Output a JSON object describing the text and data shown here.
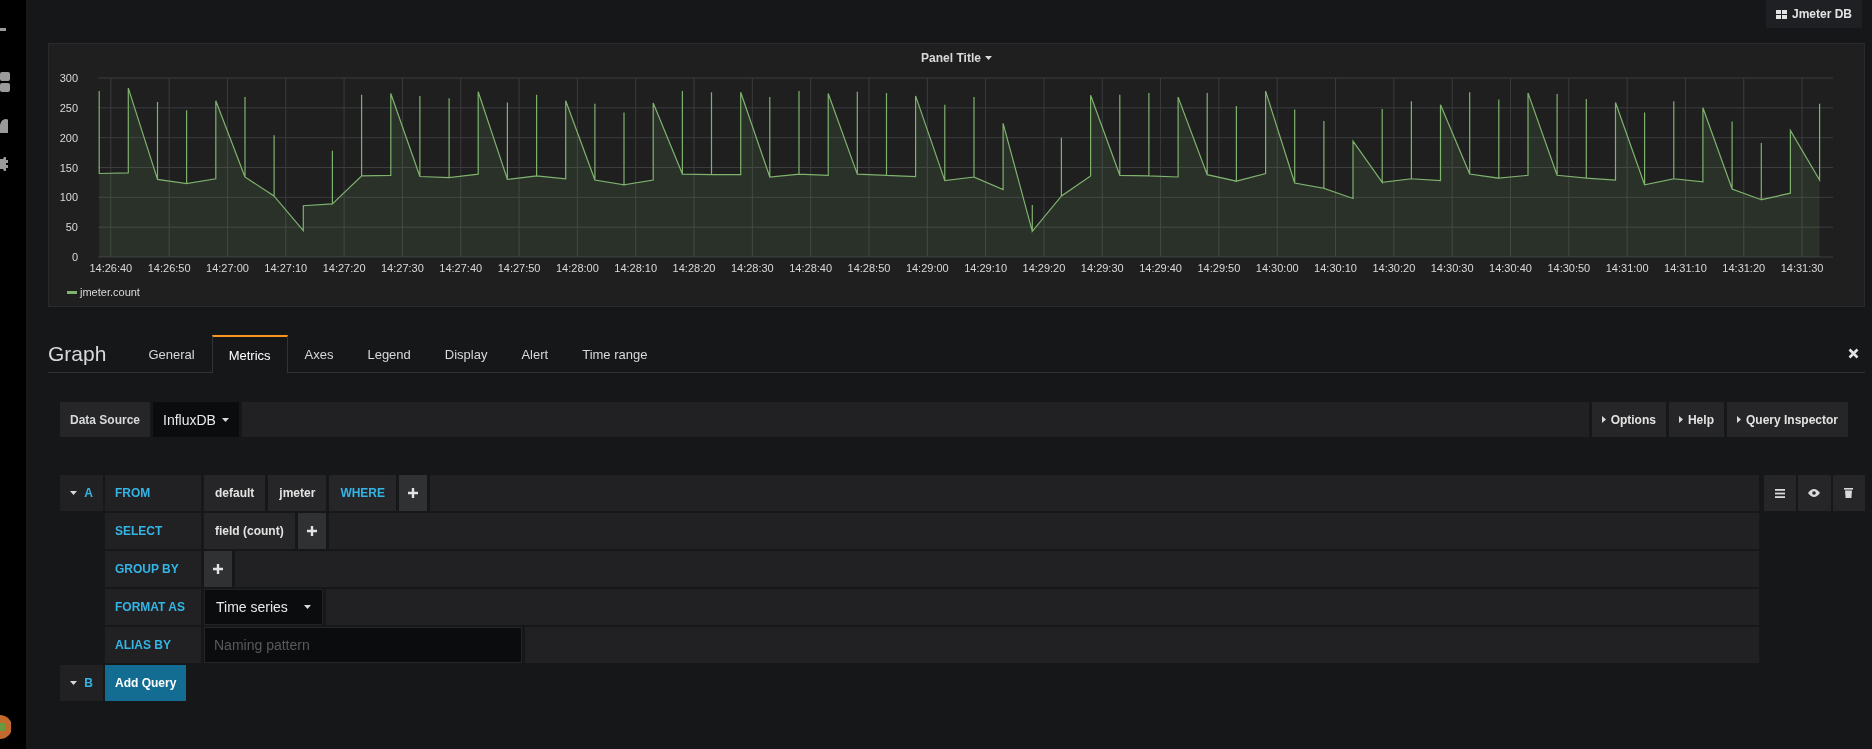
{
  "dashboard_button": {
    "label": "Jmeter DB"
  },
  "panel": {
    "chart_data": {
      "type": "area",
      "title": "Panel Title",
      "x": [
        51998,
        51998,
        52003,
        52003,
        52008,
        52008,
        52008,
        52013,
        52013,
        52013,
        52018,
        52018,
        52023,
        52023,
        52023,
        52028,
        52028,
        52028,
        52033,
        52033,
        52038,
        52038,
        52038,
        52043,
        52043,
        52043,
        52048,
        52048,
        52053,
        52053,
        52053,
        52058,
        52058,
        52058,
        52063,
        52063,
        52068,
        52068,
        52068,
        52073,
        52073,
        52073,
        52078,
        52078,
        52083,
        52083,
        52083,
        52088,
        52088,
        52088,
        52093,
        52093,
        52098,
        52098,
        52098,
        52103,
        52103,
        52103,
        52108,
        52108,
        52113,
        52113,
        52113,
        52118,
        52118,
        52118,
        52123,
        52123,
        52128,
        52128,
        52128,
        52133,
        52133,
        52133,
        52138,
        52138,
        52143,
        52143,
        52143,
        52148,
        52148,
        52148,
        52153,
        52153,
        52158,
        52158,
        52158,
        52163,
        52163,
        52163,
        52168,
        52168,
        52173,
        52173,
        52173,
        52178,
        52178,
        52178,
        52183,
        52183,
        52188,
        52188,
        52188,
        52193,
        52193,
        52193,
        52198,
        52198,
        52203,
        52203,
        52203,
        52208,
        52208,
        52208,
        52213,
        52213,
        52218,
        52218,
        52218,
        52223,
        52223,
        52223,
        52228,
        52228,
        52233,
        52233,
        52233,
        52238,
        52238,
        52238,
        52243,
        52243,
        52248,
        52248,
        52248,
        52253,
        52253,
        52253,
        52258,
        52258,
        52263,
        52263,
        52263,
        52268,
        52268,
        52268,
        52273,
        52273,
        52278,
        52278,
        52278,
        52283,
        52283,
        52283,
        52288,
        52288,
        52293,
        52293
      ],
      "series": [
        {
          "name": "jmeter.count",
          "color": "#7eb26d",
          "values": [
            278,
            140,
            141,
            283,
            130,
            260,
            130,
            123,
            246,
            123,
            131,
            262,
            134,
            268,
            134,
            102,
            204,
            102,
            44,
            86,
            89,
            178,
            89,
            136,
            272,
            136,
            137,
            274,
            135,
            270,
            135,
            133,
            266,
            133,
            139,
            277,
            130,
            259,
            130,
            136,
            272,
            136,
            131,
            262,
            129,
            257,
            129,
            121,
            242,
            121,
            129,
            258,
            139,
            278,
            139,
            138,
            276,
            138,
            138,
            276,
            134,
            268,
            134,
            139,
            278,
            139,
            137,
            274,
            139,
            277,
            139,
            137,
            275,
            137,
            135,
            270,
            128,
            255,
            128,
            134,
            268,
            134,
            113,
            224,
            43,
            87,
            43,
            102,
            200,
            102,
            136,
            271,
            137,
            272,
            137,
            136,
            275,
            136,
            134,
            268,
            138,
            275,
            138,
            127,
            253,
            127,
            140,
            278,
            124,
            247,
            124,
            115,
            228,
            115,
            98,
            194,
            125,
            248,
            125,
            131,
            261,
            131,
            128,
            255,
            139,
            276,
            139,
            132,
            264,
            132,
            137,
            275,
            137,
            273,
            137,
            132,
            265,
            132,
            129,
            259,
            121,
            242,
            121,
            131,
            261,
            131,
            126,
            250,
            114,
            227,
            114,
            96,
            191,
            96,
            107,
            212,
            129,
            257
          ]
        }
      ],
      "grid": true,
      "xlim": [
        51997.8,
        52295.3
      ],
      "ylim": [
        0,
        300
      ],
      "yticks": [
        0,
        50,
        100,
        150,
        200,
        250,
        300
      ],
      "xticks": [
        {
          "value": 52000,
          "label": "14:26:40"
        },
        {
          "value": 52010,
          "label": "14:26:50"
        },
        {
          "value": 52020,
          "label": "14:27:00"
        },
        {
          "value": 52030,
          "label": "14:27:10"
        },
        {
          "value": 52040,
          "label": "14:27:20"
        },
        {
          "value": 52050,
          "label": "14:27:30"
        },
        {
          "value": 52060,
          "label": "14:27:40"
        },
        {
          "value": 52070,
          "label": "14:27:50"
        },
        {
          "value": 52080,
          "label": "14:28:00"
        },
        {
          "value": 52090,
          "label": "14:28:10"
        },
        {
          "value": 52100,
          "label": "14:28:20"
        },
        {
          "value": 52110,
          "label": "14:28:30"
        },
        {
          "value": 52120,
          "label": "14:28:40"
        },
        {
          "value": 52130,
          "label": "14:28:50"
        },
        {
          "value": 52140,
          "label": "14:29:00"
        },
        {
          "value": 52150,
          "label": "14:29:10"
        },
        {
          "value": 52160,
          "label": "14:29:20"
        },
        {
          "value": 52170,
          "label": "14:29:30"
        },
        {
          "value": 52180,
          "label": "14:29:40"
        },
        {
          "value": 52190,
          "label": "14:29:50"
        },
        {
          "value": 52200,
          "label": "14:30:00"
        },
        {
          "value": 52210,
          "label": "14:30:10"
        },
        {
          "value": 52220,
          "label": "14:30:20"
        },
        {
          "value": 52230,
          "label": "14:30:30"
        },
        {
          "value": 52240,
          "label": "14:30:40"
        },
        {
          "value": 52250,
          "label": "14:30:50"
        },
        {
          "value": 52260,
          "label": "14:31:00"
        },
        {
          "value": 52270,
          "label": "14:31:10"
        },
        {
          "value": 52280,
          "label": "14:31:20"
        },
        {
          "value": 52290,
          "label": "14:31:30"
        }
      ]
    }
  },
  "editor": {
    "title": "Graph",
    "tabs": [
      {
        "label": "General",
        "selected": false
      },
      {
        "label": "Metrics",
        "selected": true
      },
      {
        "label": "Axes",
        "selected": false
      },
      {
        "label": "Legend",
        "selected": false
      },
      {
        "label": "Display",
        "selected": false
      },
      {
        "label": "Alert",
        "selected": false
      },
      {
        "label": "Time range",
        "selected": false
      }
    ]
  },
  "data_source": {
    "label": "Data Source",
    "value": "InfluxDB",
    "buttons": [
      "Options",
      "Help",
      "Query Inspector"
    ]
  },
  "queries": [
    {
      "letter": "A",
      "rows": [
        {
          "label": "FROM",
          "parts": [
            {
              "kind": "value",
              "text": "default"
            },
            {
              "kind": "value",
              "text": "jmeter"
            },
            {
              "kind": "keyword",
              "text": "WHERE"
            },
            {
              "kind": "add"
            }
          ]
        },
        {
          "label": "SELECT",
          "parts": [
            {
              "kind": "value",
              "text": "field (count)"
            },
            {
              "kind": "add"
            }
          ]
        },
        {
          "label": "GROUP BY",
          "parts": [
            {
              "kind": "add"
            }
          ]
        },
        {
          "label": "FORMAT AS",
          "parts": [
            {
              "kind": "select",
              "text": "Time series"
            }
          ]
        },
        {
          "label": "ALIAS BY",
          "parts": [
            {
              "kind": "input",
              "placeholder": "Naming pattern"
            }
          ]
        }
      ]
    }
  ],
  "add_query": {
    "letter": "B",
    "label": "Add Query"
  }
}
